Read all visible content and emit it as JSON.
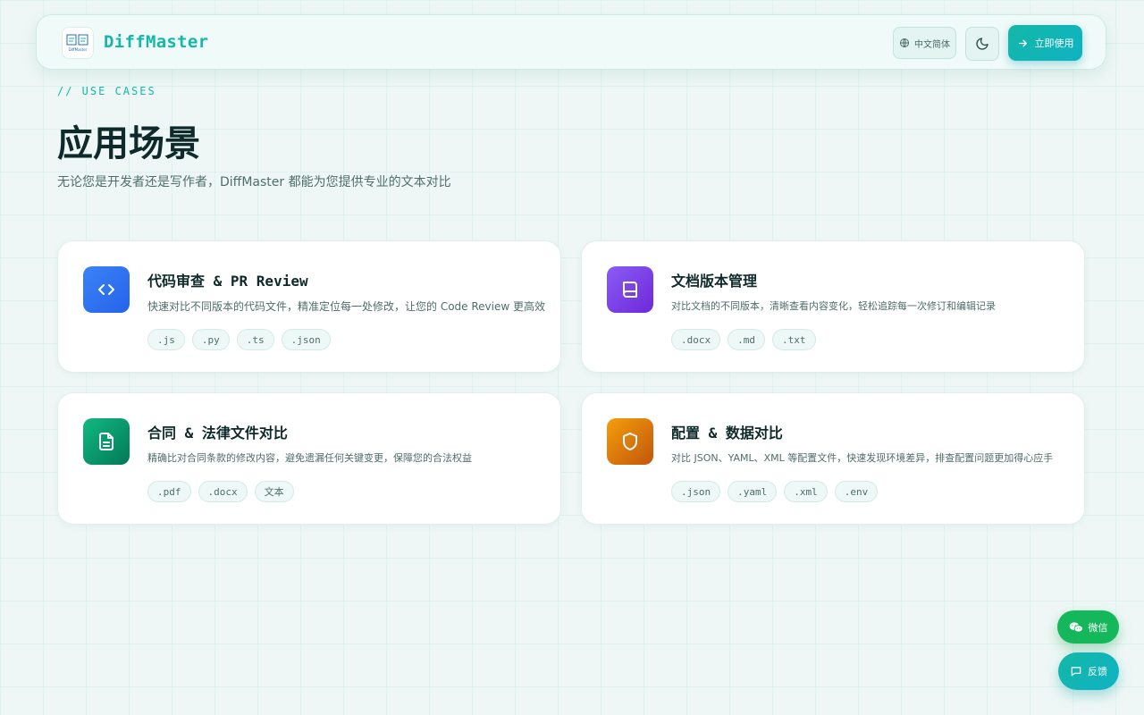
{
  "header": {
    "brand": "DiffMaster",
    "logo_text": "DiffMaster",
    "lang_label": "中文简体",
    "cta_label": "立即使用"
  },
  "hero": {
    "eyebrow": "// USE CASES",
    "title": "应用场景",
    "subtitle": "无论您是开发者还是写作者，DiffMaster 都能为您提供专业的文本对比"
  },
  "cards": [
    {
      "title": "代码审查 & PR Review",
      "description": "快速对比不同版本的代码文件，精准定位每一处修改，让您的 Code Review 更高效",
      "tags": [
        ".js",
        ".py",
        ".ts",
        ".json"
      ],
      "icon": "code-icon",
      "color_from": "#3b82f6",
      "color_to": "#2563eb"
    },
    {
      "title": "文档版本管理",
      "description": "对比文档的不同版本，清晰查看内容变化，轻松追踪每一次修订和编辑记录",
      "tags": [
        ".docx",
        ".md",
        ".txt"
      ],
      "icon": "book-icon",
      "color_from": "#8b5cf6",
      "color_to": "#6d28d9"
    },
    {
      "title": "合同 & 法律文件对比",
      "description": "精确比对合同条款的修改内容，避免遗漏任何关键变更，保障您的合法权益",
      "tags": [
        ".pdf",
        ".docx",
        "文本"
      ],
      "icon": "file-text-icon",
      "color_from": "#10b981",
      "color_to": "#047857"
    },
    {
      "title": "配置 & 数据对比",
      "description": "对比 JSON、YAML、XML 等配置文件，快速发现环境差异，排查配置问题更加得心应手",
      "tags": [
        ".json",
        ".yaml",
        ".xml",
        ".env"
      ],
      "icon": "shield-icon",
      "color_from": "#f59e0b",
      "color_to": "#c2560c"
    }
  ],
  "floating": {
    "wechat_label": "微信",
    "chat_label": "反馈"
  }
}
